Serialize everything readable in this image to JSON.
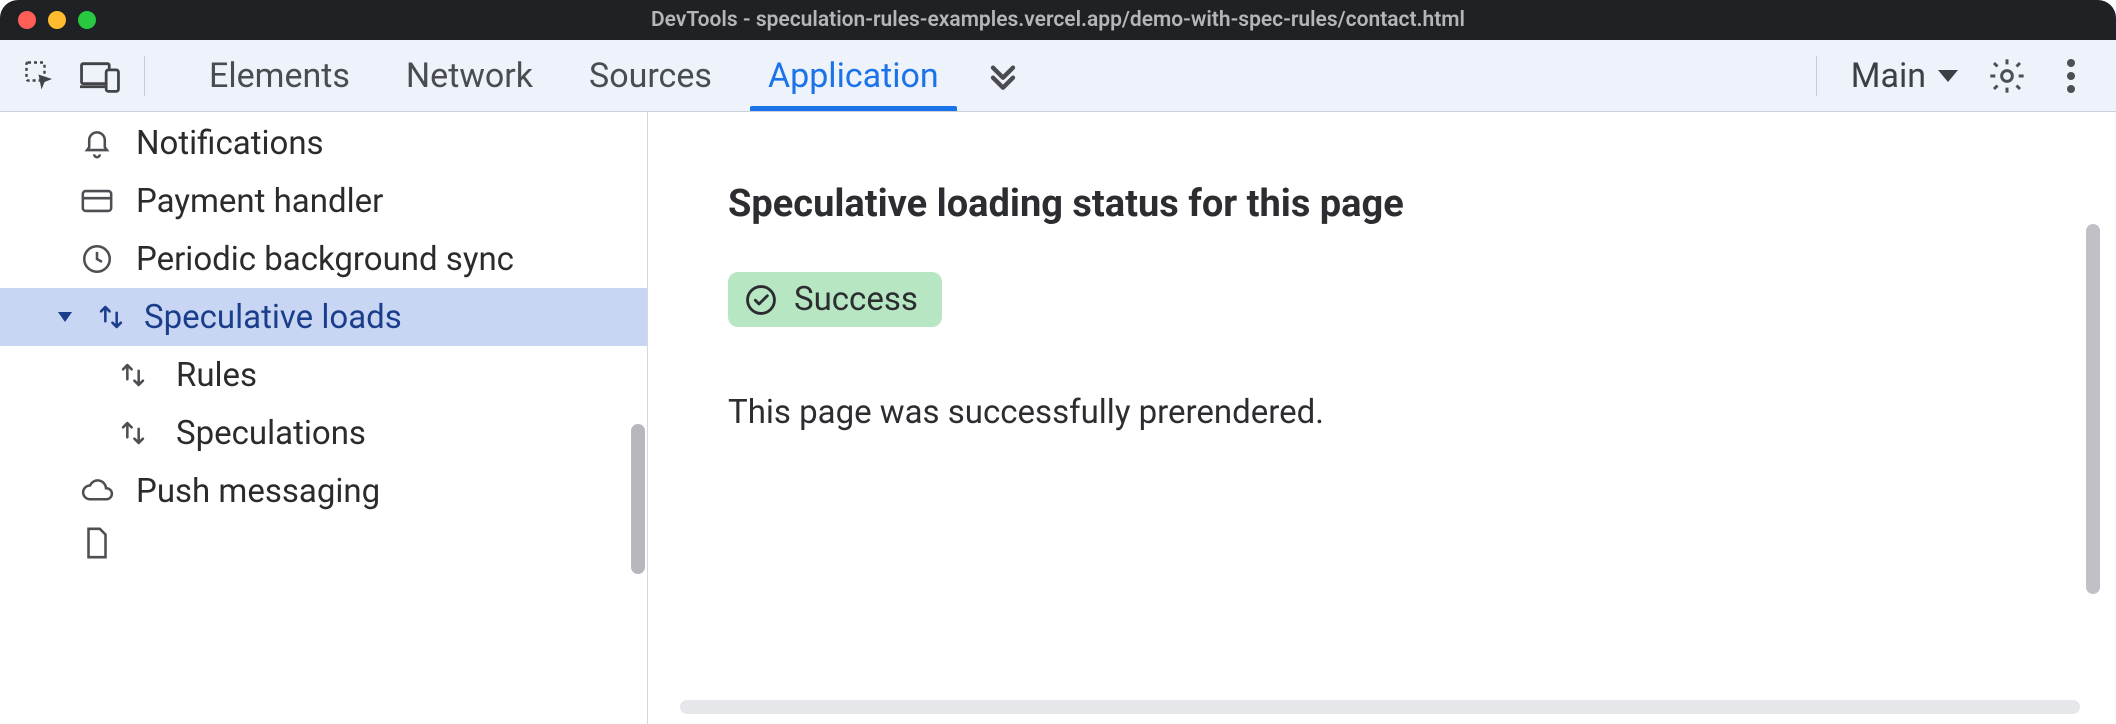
{
  "window": {
    "title": "DevTools - speculation-rules-examples.vercel.app/demo-with-spec-rules/contact.html"
  },
  "toolbar": {
    "tabs": [
      "Elements",
      "Network",
      "Sources",
      "Application"
    ],
    "active_tab_index": 3,
    "frame_selector": "Main"
  },
  "sidebar": {
    "items": [
      {
        "icon": "bell-icon",
        "label": "Notifications",
        "level": 1
      },
      {
        "icon": "card-icon",
        "label": "Payment handler",
        "level": 1
      },
      {
        "icon": "clock-icon",
        "label": "Periodic background sync",
        "level": 1
      },
      {
        "icon": "updown-icon",
        "label": "Speculative loads",
        "level": 2,
        "expandable": true,
        "selected": true
      },
      {
        "icon": "updown-icon",
        "label": "Rules",
        "level": 3
      },
      {
        "icon": "updown-icon",
        "label": "Speculations",
        "level": 3
      },
      {
        "icon": "cloud-icon",
        "label": "Push messaging",
        "level": 1
      }
    ]
  },
  "main": {
    "heading": "Speculative loading status for this page",
    "status_label": "Success",
    "description": "This page was successfully prerendered."
  }
}
